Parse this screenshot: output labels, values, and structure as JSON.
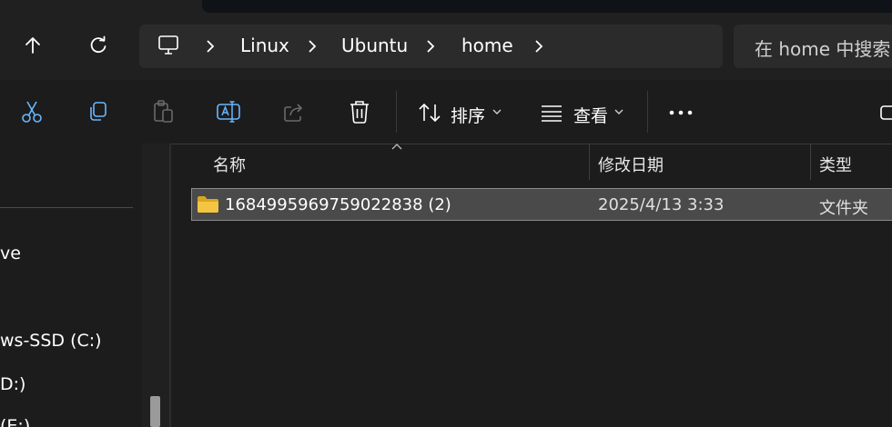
{
  "address_bar": {
    "crumbs": [
      "Linux",
      "Ubuntu",
      "home"
    ],
    "search_placeholder": "在 home 中搜索"
  },
  "toolbar": {
    "sort_label": "排序",
    "view_label": "查看"
  },
  "sidebar": {
    "items": [
      "ve",
      "ws-SSD (C:)",
      "D:)",
      "(E:)"
    ]
  },
  "file_list": {
    "columns": [
      "名称",
      "修改日期",
      "类型"
    ],
    "rows": [
      {
        "name": "1684995969759022838 (2)",
        "modified": "2025/4/13 3:33",
        "type": "文件夹"
      }
    ]
  },
  "colors": {
    "background": "#1c1c1c",
    "selected_row": "#4a4a4a",
    "folder_icon": "#f4c542",
    "accent_icon": "#6ab7ff"
  }
}
